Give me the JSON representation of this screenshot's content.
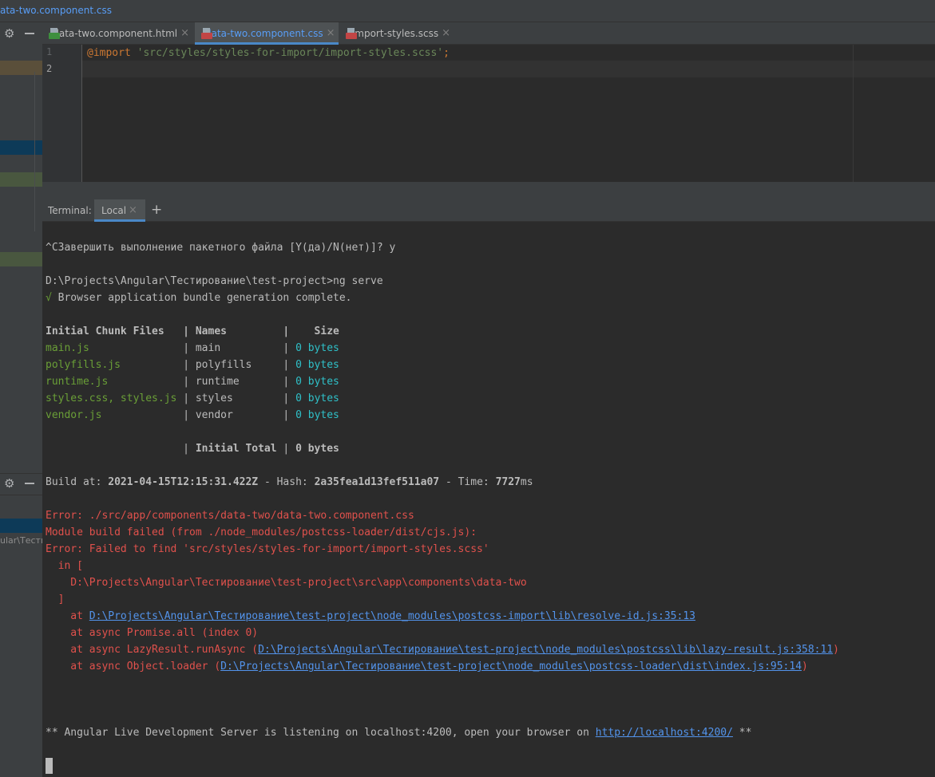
{
  "window": {
    "title": "ata-two.component.css"
  },
  "editor_tabs": [
    {
      "label": "data-two.component.html",
      "badge": "HTML",
      "badge_color": "#3e8f3e",
      "active": false
    },
    {
      "label": "data-two.component.css",
      "badge": "CSS",
      "badge_color": "#c24545",
      "active": true
    },
    {
      "label": "import-styles.scss",
      "badge": "SCSS",
      "badge_color": "#c24545",
      "active": false
    }
  ],
  "editor": {
    "line_numbers": [
      "1",
      "2"
    ],
    "line1": {
      "at_rule": "@import",
      "path": "'src/styles/styles-for-import/import-styles.scss'",
      "semicolon": ";"
    }
  },
  "terminal": {
    "header_label": "Terminal:",
    "tab_label": "Local",
    "close_glyph": "×",
    "add_glyph": "+",
    "line_prompt": "^CЗавершить выполнение пакетного файла [Y(да)/N(нет)]? y",
    "line_cmd": "D:\\Projects\\Angular\\Тестирование\\test-project>ng serve",
    "check_mark": "√",
    "bundle_msg": " Browser application bundle generation complete.",
    "table_header": "Initial Chunk Files   | Names         |    Size",
    "rows": [
      {
        "file": "main.js",
        "pad": "               | main          | ",
        "size": "0 bytes"
      },
      {
        "file": "polyfills.js",
        "pad": "          | polyfills     | ",
        "size": "0 bytes"
      },
      {
        "file": "runtime.js",
        "pad": "            | runtime       | ",
        "size": "0 bytes"
      },
      {
        "file": "styles.css, styles.js",
        "pad": " | styles        | ",
        "size": "0 bytes"
      },
      {
        "file": "vendor.js",
        "pad": "             | vendor        | ",
        "size": "0 bytes"
      }
    ],
    "total_prefix": "                      | ",
    "total_label": "Initial Total",
    "total_mid": " | ",
    "total_size": "0 bytes",
    "build_at_label": "Build at: ",
    "build_at_value": "2021-04-15T12:15:31.422Z",
    "hash_label": " - Hash: ",
    "hash_value": "2a35fea1d13fef511a07",
    "time_label": " - Time: ",
    "time_value": "7727",
    "time_unit": "ms",
    "errors": [
      "Error: ./src/app/components/data-two/data-two.component.css",
      "Module build failed (from ./node_modules/postcss-loader/dist/cjs.js):",
      "Error: Failed to find 'src/styles/styles-for-import/import-styles.scss'",
      "  in [",
      "    D:\\Projects\\Angular\\Тестирование\\test-project\\src\\app\\components\\data-two",
      "  ]"
    ],
    "stack": [
      {
        "prefix": "    at ",
        "link": "D:\\Projects\\Angular\\Тестирование\\test-project\\node_modules\\postcss-import\\lib\\resolve-id.js:35:13",
        "suffix": ""
      },
      {
        "prefix": "    at async Promise.all (index 0)",
        "link": "",
        "suffix": ""
      },
      {
        "prefix": "    at async LazyResult.runAsync (",
        "link": "D:\\Projects\\Angular\\Тестирование\\test-project\\node_modules\\postcss\\lib\\lazy-result.js:358:11",
        "suffix": ")"
      },
      {
        "prefix": "    at async Object.loader (",
        "link": "D:\\Projects\\Angular\\Тестирование\\test-project\\node_modules\\postcss-loader\\dist\\index.js:95:14",
        "suffix": ")"
      }
    ],
    "server_prefix": "** Angular Live Development Server is listening on localhost:4200, open your browser on ",
    "server_link": "http://localhost:4200/",
    "server_suffix": " **"
  },
  "left_panel": {
    "path_fragment": "ular\\Тестир"
  },
  "colors": {
    "accent": "#4a88c7",
    "error": "#e0514c",
    "green": "#6a9f37",
    "cyan": "#2fc0c8",
    "link": "#5394ec"
  }
}
